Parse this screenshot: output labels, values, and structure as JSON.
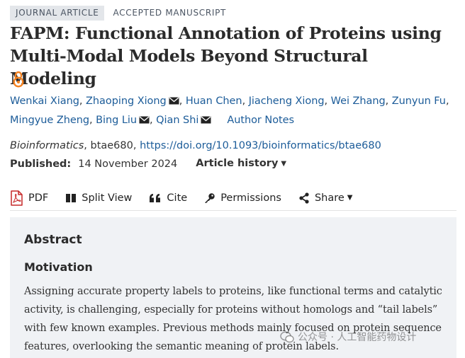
{
  "tags": {
    "journal_article": "JOURNAL ARTICLE",
    "accepted_manuscript": "ACCEPTED MANUSCRIPT"
  },
  "article": {
    "title": "FAPM: Functional Annotation of Proteins using Multi-Modal Models Beyond Structural Modeling",
    "open_access_icon": "open-access-icon"
  },
  "authors": [
    {
      "name": "Wenkai Xiang",
      "mail": false,
      "sep": ", "
    },
    {
      "name": "Zhaoping Xiong",
      "mail": true,
      "sep": ", "
    },
    {
      "name": "Huan Chen",
      "mail": false,
      "sep": ", "
    },
    {
      "name": "Jiacheng Xiong",
      "mail": false,
      "sep": ", "
    },
    {
      "name": "Wei Zhang",
      "mail": false,
      "sep": ", "
    },
    {
      "name": "Zunyun Fu",
      "mail": false,
      "sep": ","
    },
    {
      "name": "Mingyue Zheng",
      "mail": false,
      "sep": ", "
    },
    {
      "name": "Bing Liu",
      "mail": true,
      "sep": ", "
    },
    {
      "name": "Qian Shi",
      "mail": true,
      "sep": ""
    }
  ],
  "author_notes": "Author Notes",
  "citation": {
    "journal": "Bioinformatics",
    "article_id": ", btae680, ",
    "doi": "https://doi.org/10.1093/bioinformatics/btae680"
  },
  "published": {
    "label": "Published:",
    "date": "14 November 2024",
    "history": "Article history"
  },
  "toolbar": {
    "pdf": "PDF",
    "split_view": "Split View",
    "cite": "Cite",
    "permissions": "Permissions",
    "share": "Share"
  },
  "abstract": {
    "heading": "Abstract",
    "subheading": "Motivation",
    "text": "Assigning accurate property labels to proteins, like functional terms and catalytic activity, is challenging, especially for proteins without homologs and “tail labels” with few known examples. Previous methods mainly focused on protein sequence features, overlooking the semantic meaning of protein labels."
  },
  "watermark": {
    "text": "公众号 · 人工智能药物设计"
  },
  "colors": {
    "link": "#1c5c99",
    "oa_orange": "#f58220",
    "pdf_red": "#c62828",
    "abstract_bg": "#f0f2f5",
    "tag_bg": "#e3e6ea"
  }
}
